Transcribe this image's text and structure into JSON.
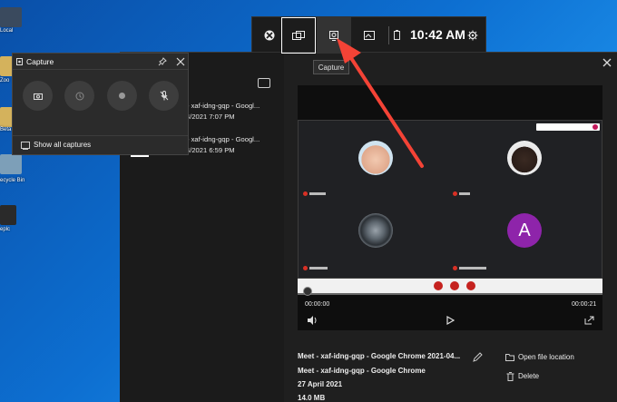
{
  "desktop": {
    "icons": [
      {
        "label": "",
        "icon": "folder-icon",
        "color": "#2f3b4a"
      },
      {
        "label": "Local",
        "icon": "folder-icon",
        "color": "#c9a24a"
      },
      {
        "label": "Zoo",
        "icon": "folder-icon",
        "color": "#d4b25c"
      },
      {
        "label": "Beta",
        "icon": "folder-icon",
        "color": "#d4b25c"
      },
      {
        "label": "ecycle Bin",
        "icon": "recycle-bin-icon",
        "color": "#7d9fb8"
      },
      {
        "label": "eplc",
        "icon": "file-icon",
        "color": "#2a2a2a"
      }
    ]
  },
  "gamebar": {
    "time": "10:42 AM",
    "buttons": [
      "xbox-icon",
      "widget-menu-icon",
      "capture-icon",
      "gallery-icon",
      "battery-icon",
      "settings-icon"
    ]
  },
  "tooltip": {
    "text": "Capture"
  },
  "capture_widget": {
    "title": "Capture",
    "show_all": "Show all captures",
    "buttons": [
      "screenshot-icon",
      "record-last-icon",
      "record-icon",
      "mic-off-icon"
    ]
  },
  "gallery": {
    "items": [
      {
        "title": "- xaf-idng-gqp - Googl...",
        "date": "4/2021 7:07 PM"
      },
      {
        "title": "- xaf-idng-gqp - Googl...",
        "date": "4/2021 6:59 PM"
      }
    ],
    "player": {
      "current_time": "00:00:00",
      "duration": "00:00:21"
    },
    "details": {
      "file_title": "Meet - xaf-idng-gqp - Google Chrome 2021-04...",
      "window_title": "Meet - xaf-idng-gqp - Google Chrome",
      "date": "27 April 2021",
      "size": "14.0 MB",
      "open_location": "Open file location",
      "delete": "Delete"
    },
    "meet": {
      "avatar_letter": "A",
      "avatar_color": "#8e24aa"
    }
  },
  "colors": {
    "arrow": "#f44336"
  }
}
